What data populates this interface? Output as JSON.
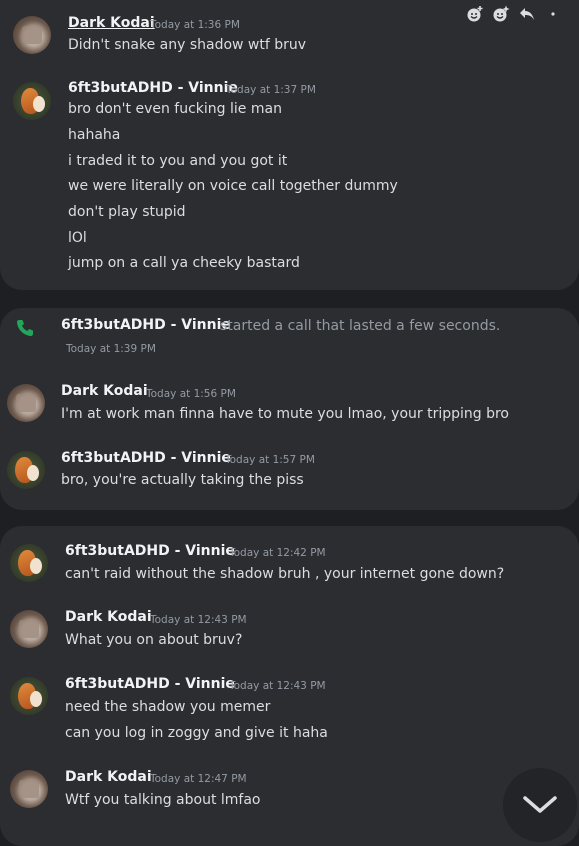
{
  "colors": {
    "background": "#1e1f22",
    "card": "#2b2d31",
    "call_icon": "#23a55a",
    "timestamp": "#949ba4"
  },
  "toolbar": {
    "icons": [
      "add-reaction-icon",
      "add-super-reaction-icon",
      "reply-icon",
      "more-icon"
    ]
  },
  "group1": {
    "msg1": {
      "author": "Dark Kodai",
      "timestamp": "Today at 1:36 PM",
      "lines": [
        "Didn't snake any shadow wtf bruv"
      ]
    },
    "msg2": {
      "author": "6ft3butADHD - Vinnie",
      "timestamp": "Today at 1:37 PM",
      "lines": [
        "bro don't even fucking lie man",
        "hahaha",
        "i traded it to you and you got it",
        "we were literally on voice call together dummy",
        "don't play stupid",
        "lOl",
        "jump on a call ya cheeky bastard"
      ]
    }
  },
  "group2": {
    "call": {
      "author": "6ft3butADHD - Vinnie",
      "text": "started a call that lasted a few seconds.",
      "timestamp": "Today at 1:39 PM"
    },
    "msg1": {
      "author": "Dark Kodai",
      "timestamp": "Today at 1:56 PM",
      "lines": [
        "I'm at work man finna have to mute you lmao, your tripping bro"
      ]
    },
    "msg2": {
      "author": "6ft3butADHD - Vinnie",
      "timestamp": "Today at 1:57 PM",
      "lines": [
        "bro, you're actually taking the piss"
      ]
    }
  },
  "group3": {
    "msg1": {
      "author": "6ft3butADHD - Vinnie",
      "timestamp": "Today at 12:42 PM",
      "lines": [
        "can't raid without the shadow bruh , your internet gone down?"
      ]
    },
    "msg2": {
      "author": "Dark Kodai",
      "timestamp": "Today at 12:43 PM",
      "lines": [
        "What you on about bruv?"
      ]
    },
    "msg3": {
      "author": "6ft3butADHD - Vinnie",
      "timestamp": "Today at 12:43 PM",
      "lines": [
        "need the shadow you memer",
        "can you log in zoggy and give it haha"
      ]
    },
    "msg4": {
      "author": "Dark Kodai",
      "timestamp": "Today at 12:47 PM",
      "lines": [
        "Wtf you talking about lmfao"
      ]
    }
  }
}
